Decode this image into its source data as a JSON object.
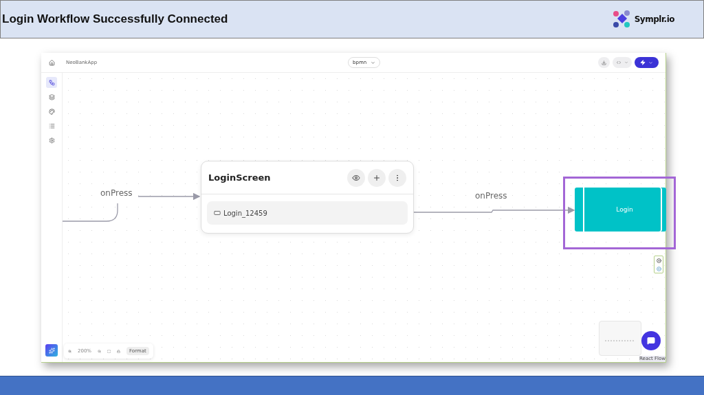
{
  "slide": {
    "title": "Login Workflow Successfully Connected",
    "logo_text": "Symplr.io"
  },
  "app": {
    "project": "NeoBankApp",
    "mode_select": "bpmn",
    "sidebar": [
      {
        "kind": "home",
        "selected": false
      },
      {
        "kind": "flow",
        "selected": true
      },
      {
        "kind": "layers",
        "selected": false
      },
      {
        "kind": "palette",
        "selected": false
      },
      {
        "kind": "list",
        "selected": false
      },
      {
        "kind": "settings",
        "selected": false
      }
    ],
    "canvas": {
      "edges": [
        {
          "label": "onPress"
        },
        {
          "label": "onPress"
        }
      ],
      "node": {
        "title": "LoginScreen",
        "item": "Login_12459"
      },
      "target": {
        "label": "Login",
        "highlighted": true
      }
    },
    "zoom_bar": {
      "zoom": "200%",
      "format": "Format"
    },
    "minimap": {
      "attribution": "React Flow"
    }
  }
}
